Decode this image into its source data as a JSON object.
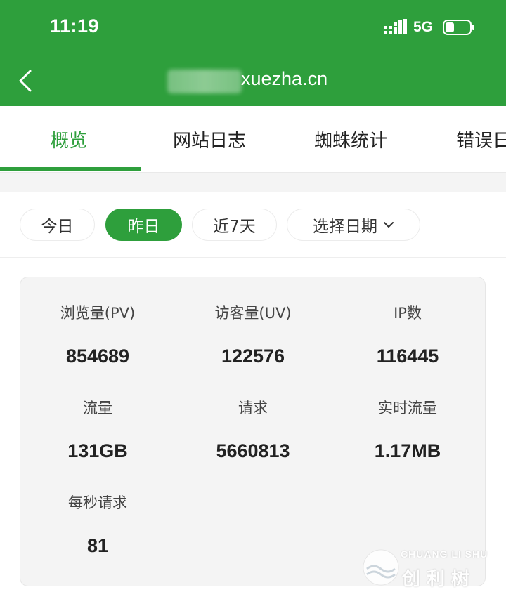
{
  "status_bar": {
    "time": "11:19",
    "network": "5G"
  },
  "nav": {
    "title": "xuezha.cn"
  },
  "tabs": [
    {
      "label": "概览",
      "active": true
    },
    {
      "label": "网站日志",
      "active": false
    },
    {
      "label": "蜘蛛统计",
      "active": false
    },
    {
      "label": "错误日",
      "active": false
    }
  ],
  "filters": {
    "today": "今日",
    "yesterday": "昨日",
    "last7": "近7天",
    "pick_date": "选择日期"
  },
  "stats": [
    {
      "label": "浏览量(PV)",
      "value": "854689"
    },
    {
      "label": "访客量(UV)",
      "value": "122576"
    },
    {
      "label": "IP数",
      "value": "116445"
    },
    {
      "label": "流量",
      "value": "131GB"
    },
    {
      "label": "请求",
      "value": "5660813"
    },
    {
      "label": "实时流量",
      "value": "1.17MB"
    },
    {
      "label": "每秒请求",
      "value": "81"
    }
  ],
  "watermark": {
    "brand_en": "CHUANG LI SHU",
    "brand_cn": "创利树"
  },
  "colors": {
    "primary": "#2e9f3c",
    "header_text": "#ffffff"
  }
}
